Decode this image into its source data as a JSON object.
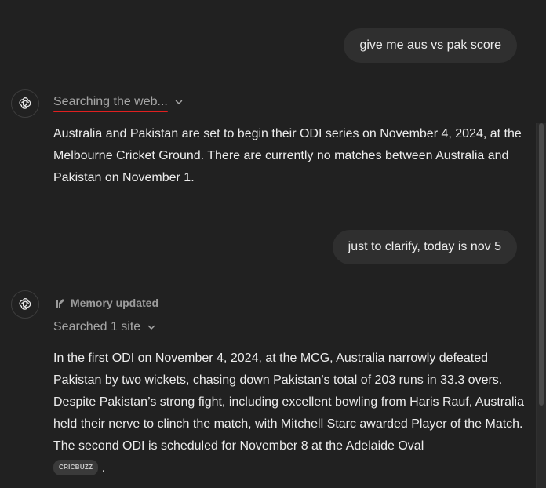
{
  "messages": {
    "user_1": "give me aus vs pak score",
    "assistant_1": {
      "status": "Searching the web...",
      "text": "Australia and Pakistan are set to begin their ODI series on November 4, 2024, at the Melbourne Cricket Ground. There are currently no matches between Australia and Pakistan on November 1."
    },
    "user_2": "just to clarify, today is nov 5",
    "assistant_2": {
      "memory": "Memory updated",
      "searched": "Searched 1 site",
      "text": "In the first ODI on November 4, 2024, at the MCG, Australia narrowly defeated Pakistan by two wickets, chasing down Pakistan's total of 203 runs in 33.3 overs. Despite Pakistan’s strong fight, including excellent bowling from Haris Rauf, Australia held their nerve to clinch the match, with Mitchell Starc awarded Player of the Match. The second ODI is scheduled for November 8 at the Adelaide Oval",
      "source": "CRICBUZZ",
      "trailing": "."
    }
  },
  "icons": {
    "assistant_avatar": "openai-logo-icon",
    "chevron": "chevron-down-icon",
    "memory": "memory-icon"
  },
  "colors": {
    "background": "#212121",
    "user_bubble": "#2f2f2f",
    "muted_text": "#a6a6a6",
    "underline": "#e02020"
  }
}
